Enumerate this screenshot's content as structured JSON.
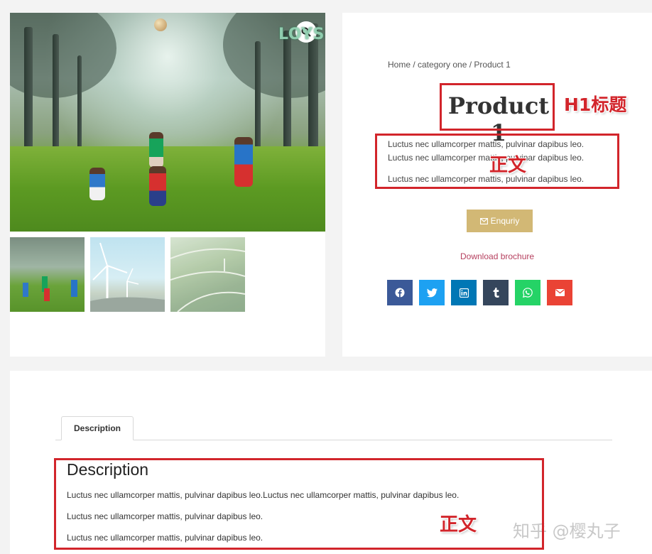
{
  "gallery": {
    "watermark": "LOYSEO.COM",
    "zoom_icon": "magnifier-icon",
    "thumbnails": [
      "kids-in-forest",
      "wind-turbines",
      "green-fields"
    ]
  },
  "summary": {
    "breadcrumb": "Home / category one / Product 1",
    "title": "Product 1",
    "short_description": [
      "Luctus nec ullamcorper mattis, pulvinar dapibus leo.",
      "Luctus nec ullamcorper mattis, pulvinar dapibus leo.",
      "Luctus nec ullamcorper mattis, pulvinar dapibus leo."
    ],
    "enquiry_label": "Enquriy",
    "download_label": "Download brochure",
    "share_buttons": [
      {
        "icon": "facebook-icon",
        "color": "#3b5998"
      },
      {
        "icon": "twitter-icon",
        "color": "#1da1f2"
      },
      {
        "icon": "linkedin-icon",
        "color": "#0077b5"
      },
      {
        "icon": "tumblr-icon",
        "color": "#35465c"
      },
      {
        "icon": "whatsapp-icon",
        "color": "#25d366"
      },
      {
        "icon": "email-icon",
        "color": "#ea4335"
      }
    ]
  },
  "tabs": {
    "active_tab": "Description",
    "heading": "Description",
    "paragraphs": [
      "Luctus nec ullamcorper mattis, pulvinar dapibus leo.Luctus nec ullamcorper mattis, pulvinar dapibus leo.",
      "Luctus nec ullamcorper mattis, pulvinar dapibus leo.",
      "Luctus nec ullamcorper mattis, pulvinar dapibus leo."
    ]
  },
  "annotations": {
    "h1_label": "H1标题",
    "body_label_1": "正文",
    "body_label_2": "正文",
    "color": "#d2252b"
  },
  "credit": "知乎 @樱丸子"
}
